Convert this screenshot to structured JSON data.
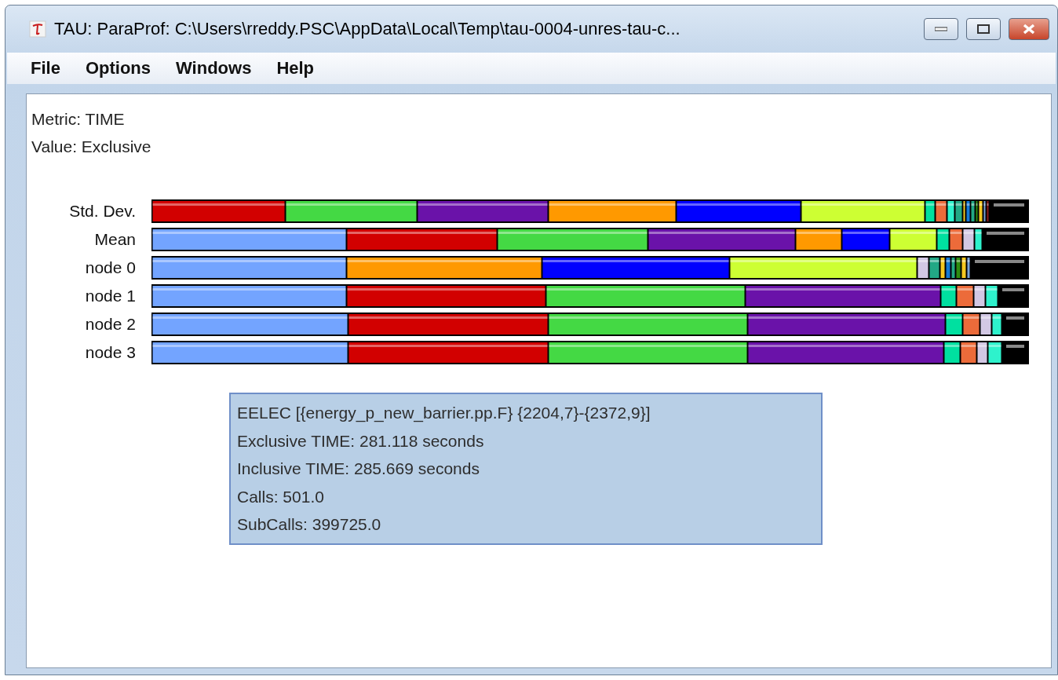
{
  "window": {
    "title": "TAU: ParaProf: C:\\Users\\rreddy.PSC\\AppData\\Local\\Temp\\tau-0004-unres-tau-c..."
  },
  "menu": [
    "File",
    "Options",
    "Windows",
    "Help"
  ],
  "info": [
    "Metric: TIME",
    "Value: Exclusive"
  ],
  "rows": [
    {
      "label": "Std. Dev."
    },
    {
      "label": "Mean"
    },
    {
      "label": "node 0"
    },
    {
      "label": "node 1"
    },
    {
      "label": "node 2"
    },
    {
      "label": "node 3"
    }
  ],
  "tooltip": [
    "EELEC [{energy_p_new_barrier.pp.F} {2204,7}-{2372,9}]",
    "Exclusive TIME: 281.118 seconds",
    "Inclusive TIME: 285.669 seconds",
    "Calls: 501.0",
    "SubCalls: 399725.0"
  ]
}
